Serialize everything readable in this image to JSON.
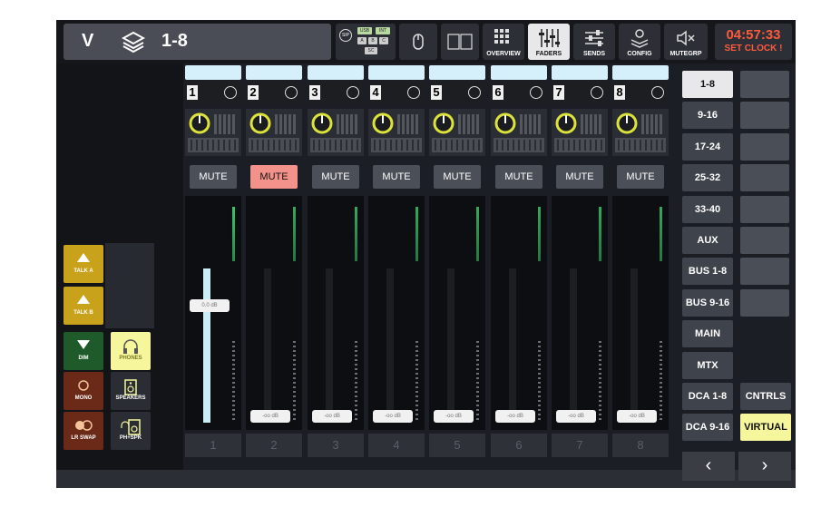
{
  "header": {
    "bank_letter": "V",
    "bank_label": "1-8",
    "usb_buttons": [
      "SIP",
      "USB",
      "INT",
      "A",
      "B",
      "C",
      "SC"
    ],
    "nav_tabs": [
      {
        "label": "OVERVIEW",
        "icon": "grid-icon"
      },
      {
        "label": "FADERS",
        "icon": "faders-icon",
        "selected": true
      },
      {
        "label": "SENDS",
        "icon": "sends-icon"
      },
      {
        "label": "CONFIG",
        "icon": "config-icon"
      },
      {
        "label": "MUTEGRP",
        "icon": "speaker-mute-icon"
      }
    ],
    "clock_time": "04:57:33",
    "clock_warning": "SET CLOCK !"
  },
  "talkback": {
    "talk_a": "TALK A",
    "talk_b": "TALK B",
    "dim": "DIM",
    "mono": "MONO",
    "lr_swap": "LR SWAP",
    "phones": "PHONES",
    "speakers": "SPEAKERS",
    "ph_spk": "PH+SPK"
  },
  "channels": [
    {
      "number": "1",
      "label": "1",
      "mute": false,
      "fader_db": "0.0 dB",
      "fader_level": 0.8
    },
    {
      "number": "2",
      "label": "2",
      "mute": true,
      "fader_db": "-oo dB",
      "fader_level": 0
    },
    {
      "number": "3",
      "label": "3",
      "mute": false,
      "fader_db": "-oo dB",
      "fader_level": 0
    },
    {
      "number": "4",
      "label": "4",
      "mute": false,
      "fader_db": "-oo dB",
      "fader_level": 0
    },
    {
      "number": "5",
      "label": "5",
      "mute": false,
      "fader_db": "-oo dB",
      "fader_level": 0
    },
    {
      "number": "6",
      "label": "6",
      "mute": false,
      "fader_db": "-oo dB",
      "fader_level": 0
    },
    {
      "number": "7",
      "label": "7",
      "mute": false,
      "fader_db": "-oo dB",
      "fader_level": 0
    },
    {
      "number": "8",
      "label": "8",
      "mute": false,
      "fader_db": "-oo dB",
      "fader_level": 0
    }
  ],
  "mute_label": "MUTE",
  "layers": [
    "1-8",
    "9-16",
    "17-24",
    "25-32",
    "33-40",
    "AUX",
    "BUS 1-8",
    "BUS 9-16",
    "MAIN",
    "MTX",
    "DCA 1-8",
    "DCA 9-16"
  ],
  "selected_layer": "1-8",
  "extra_buttons": {
    "cntrls": "CNTRLS",
    "virtual": "VIRTUAL"
  },
  "nav": {
    "prev": "‹",
    "next": "›"
  },
  "colors": {
    "accent_cyan": "#d6f0fb",
    "mute_active": "#f2928a",
    "clock": "#ff5a3c",
    "talk": "#c9a21c",
    "virtual": "#f6f79c"
  }
}
